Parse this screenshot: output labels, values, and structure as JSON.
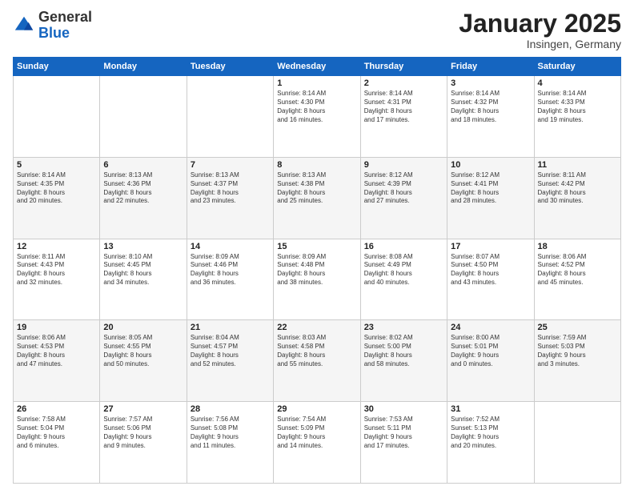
{
  "header": {
    "logo_general": "General",
    "logo_blue": "Blue",
    "month_title": "January 2025",
    "subtitle": "Insingen, Germany"
  },
  "days_of_week": [
    "Sunday",
    "Monday",
    "Tuesday",
    "Wednesday",
    "Thursday",
    "Friday",
    "Saturday"
  ],
  "weeks": [
    [
      {
        "day": "",
        "info": ""
      },
      {
        "day": "",
        "info": ""
      },
      {
        "day": "",
        "info": ""
      },
      {
        "day": "1",
        "info": "Sunrise: 8:14 AM\nSunset: 4:30 PM\nDaylight: 8 hours\nand 16 minutes."
      },
      {
        "day": "2",
        "info": "Sunrise: 8:14 AM\nSunset: 4:31 PM\nDaylight: 8 hours\nand 17 minutes."
      },
      {
        "day": "3",
        "info": "Sunrise: 8:14 AM\nSunset: 4:32 PM\nDaylight: 8 hours\nand 18 minutes."
      },
      {
        "day": "4",
        "info": "Sunrise: 8:14 AM\nSunset: 4:33 PM\nDaylight: 8 hours\nand 19 minutes."
      }
    ],
    [
      {
        "day": "5",
        "info": "Sunrise: 8:14 AM\nSunset: 4:35 PM\nDaylight: 8 hours\nand 20 minutes."
      },
      {
        "day": "6",
        "info": "Sunrise: 8:13 AM\nSunset: 4:36 PM\nDaylight: 8 hours\nand 22 minutes."
      },
      {
        "day": "7",
        "info": "Sunrise: 8:13 AM\nSunset: 4:37 PM\nDaylight: 8 hours\nand 23 minutes."
      },
      {
        "day": "8",
        "info": "Sunrise: 8:13 AM\nSunset: 4:38 PM\nDaylight: 8 hours\nand 25 minutes."
      },
      {
        "day": "9",
        "info": "Sunrise: 8:12 AM\nSunset: 4:39 PM\nDaylight: 8 hours\nand 27 minutes."
      },
      {
        "day": "10",
        "info": "Sunrise: 8:12 AM\nSunset: 4:41 PM\nDaylight: 8 hours\nand 28 minutes."
      },
      {
        "day": "11",
        "info": "Sunrise: 8:11 AM\nSunset: 4:42 PM\nDaylight: 8 hours\nand 30 minutes."
      }
    ],
    [
      {
        "day": "12",
        "info": "Sunrise: 8:11 AM\nSunset: 4:43 PM\nDaylight: 8 hours\nand 32 minutes."
      },
      {
        "day": "13",
        "info": "Sunrise: 8:10 AM\nSunset: 4:45 PM\nDaylight: 8 hours\nand 34 minutes."
      },
      {
        "day": "14",
        "info": "Sunrise: 8:09 AM\nSunset: 4:46 PM\nDaylight: 8 hours\nand 36 minutes."
      },
      {
        "day": "15",
        "info": "Sunrise: 8:09 AM\nSunset: 4:48 PM\nDaylight: 8 hours\nand 38 minutes."
      },
      {
        "day": "16",
        "info": "Sunrise: 8:08 AM\nSunset: 4:49 PM\nDaylight: 8 hours\nand 40 minutes."
      },
      {
        "day": "17",
        "info": "Sunrise: 8:07 AM\nSunset: 4:50 PM\nDaylight: 8 hours\nand 43 minutes."
      },
      {
        "day": "18",
        "info": "Sunrise: 8:06 AM\nSunset: 4:52 PM\nDaylight: 8 hours\nand 45 minutes."
      }
    ],
    [
      {
        "day": "19",
        "info": "Sunrise: 8:06 AM\nSunset: 4:53 PM\nDaylight: 8 hours\nand 47 minutes."
      },
      {
        "day": "20",
        "info": "Sunrise: 8:05 AM\nSunset: 4:55 PM\nDaylight: 8 hours\nand 50 minutes."
      },
      {
        "day": "21",
        "info": "Sunrise: 8:04 AM\nSunset: 4:57 PM\nDaylight: 8 hours\nand 52 minutes."
      },
      {
        "day": "22",
        "info": "Sunrise: 8:03 AM\nSunset: 4:58 PM\nDaylight: 8 hours\nand 55 minutes."
      },
      {
        "day": "23",
        "info": "Sunrise: 8:02 AM\nSunset: 5:00 PM\nDaylight: 8 hours\nand 58 minutes."
      },
      {
        "day": "24",
        "info": "Sunrise: 8:00 AM\nSunset: 5:01 PM\nDaylight: 9 hours\nand 0 minutes."
      },
      {
        "day": "25",
        "info": "Sunrise: 7:59 AM\nSunset: 5:03 PM\nDaylight: 9 hours\nand 3 minutes."
      }
    ],
    [
      {
        "day": "26",
        "info": "Sunrise: 7:58 AM\nSunset: 5:04 PM\nDaylight: 9 hours\nand 6 minutes."
      },
      {
        "day": "27",
        "info": "Sunrise: 7:57 AM\nSunset: 5:06 PM\nDaylight: 9 hours\nand 9 minutes."
      },
      {
        "day": "28",
        "info": "Sunrise: 7:56 AM\nSunset: 5:08 PM\nDaylight: 9 hours\nand 11 minutes."
      },
      {
        "day": "29",
        "info": "Sunrise: 7:54 AM\nSunset: 5:09 PM\nDaylight: 9 hours\nand 14 minutes."
      },
      {
        "day": "30",
        "info": "Sunrise: 7:53 AM\nSunset: 5:11 PM\nDaylight: 9 hours\nand 17 minutes."
      },
      {
        "day": "31",
        "info": "Sunrise: 7:52 AM\nSunset: 5:13 PM\nDaylight: 9 hours\nand 20 minutes."
      },
      {
        "day": "",
        "info": ""
      }
    ]
  ]
}
